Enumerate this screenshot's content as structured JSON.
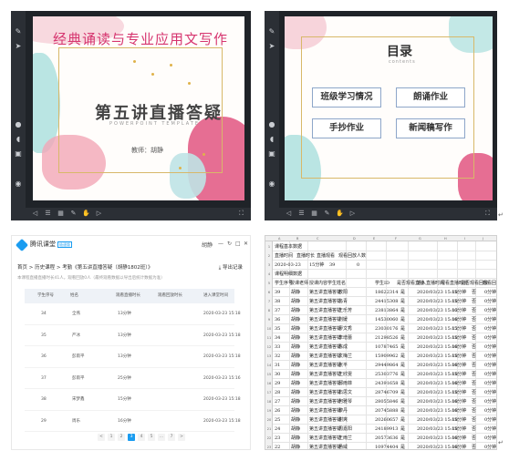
{
  "slide1": {
    "title": "经典诵读与专业应用文写作",
    "main_title": "第五讲直播答疑",
    "subtitle": "POWERPOINT TEMPLATE",
    "teacher": "教师：胡静"
  },
  "slide2": {
    "title": "目录",
    "subtitle": "contents",
    "items": [
      "班级学习情况",
      "朗诵作业",
      "手抄作业",
      "新闻稿写作"
    ]
  },
  "tencent": {
    "app_name": "腾讯课堂",
    "badge": "极速版",
    "user": "胡静",
    "window_controls": [
      "—",
      "↻",
      "□",
      "✕"
    ],
    "breadcrumb": "首页 > 历史课程 > 考勤《第五讲直播答疑（胡静1802班）》",
    "export_label": "导出记录",
    "note": "本课程直播直播时长41人，观看回放0人（最终观看数据以导出后统计数据为准）",
    "columns": [
      "学生序号",
      "姓名",
      "观看直播时长",
      "观看回放时长",
      "进入课堂时间"
    ],
    "rows": [
      [
        "34",
        "全燕",
        "13分钟",
        "",
        "2020-03-23 15:18"
      ],
      [
        "35",
        "严冰",
        "13分钟",
        "",
        "2020-03-23 15:18"
      ],
      [
        "36",
        "彭雨平",
        "13分钟",
        "",
        "2020-03-23 15:18"
      ],
      [
        "37",
        "彭雨平",
        "25分钟",
        "",
        "2020-03-23 15:16"
      ],
      [
        "38",
        "宋梦鑫",
        "15分钟",
        "",
        "2020-03-23 15:18"
      ],
      [
        "29",
        "周乐",
        "16分钟",
        "",
        "2020-03-23 15:18"
      ]
    ],
    "pager": [
      "<",
      "1",
      "2",
      "3",
      "4",
      "5",
      "...",
      "7",
      ">"
    ],
    "active_page": "3"
  },
  "sheet": {
    "col_letters": [
      "A",
      "B",
      "C",
      "D",
      "E",
      "F",
      "G",
      "H",
      "I",
      "J"
    ],
    "header_rows": [
      {
        "num": "1",
        "cells": [
          "课程基本数据"
        ]
      },
      {
        "num": "2",
        "cells": [
          "直播时间",
          "直播时长",
          "直播观看",
          "观看回放人数"
        ]
      },
      {
        "num": "3",
        "cells": [
          "2020-03-23",
          "15分钟",
          "39",
          "0"
        ]
      },
      {
        "num": "4",
        "cells": [
          "课程明细数据"
        ]
      },
      {
        "num": "5",
        "cells": [
          "学生序号",
          "授课老师",
          "授课内容",
          "学生姓名",
          "学生ID",
          "是否观看直播",
          "进入直播时间",
          "观看直播时长",
          "是否观看回放",
          "观看回放时长"
        ]
      }
    ],
    "data_rows": [
      {
        "num": "6",
        "cells": [
          "39",
          "胡静",
          "第五讲直播答疑",
          "欧阳",
          "18622314",
          "是",
          "2020/03/23 15:18",
          "15分钟",
          "否",
          "0分钟"
        ]
      },
      {
        "num": "7",
        "cells": [
          "38",
          "胡静",
          "第五讲直播答疑",
          "冯青",
          "24415308",
          "是",
          "2020/03/23 15:18",
          "15分钟",
          "否",
          "0分钟"
        ]
      },
      {
        "num": "8",
        "cells": [
          "37",
          "胡静",
          "第五讲直播答疑",
          "王乐芳",
          "23813864",
          "是",
          "2020/03/23 15:13",
          "16分钟",
          "否",
          "0分钟"
        ]
      },
      {
        "num": "9",
        "cells": [
          "36",
          "胡静",
          "第五讲直播答疑",
          "刘媛",
          "14530060",
          "是",
          "2020/03/23 15:18",
          "16分钟",
          "否",
          "0分钟"
        ]
      },
      {
        "num": "10",
        "cells": [
          "35",
          "胡静",
          "第五讲直播答疑",
          "廖文秀",
          "23030176",
          "是",
          "2020/03/23 15:13",
          "15分钟",
          "否",
          "0分钟"
        ]
      },
      {
        "num": "11",
        "cells": [
          "34",
          "胡静",
          "第五讲直播答疑",
          "李增蕾",
          "21298526",
          "是",
          "2020/03/23 15:18",
          "15分钟",
          "否",
          "0分钟"
        ]
      },
      {
        "num": "12",
        "cells": [
          "33",
          "胡静",
          "第五讲直播答疑",
          "陈成",
          "10787465",
          "是",
          "2020/03/23 15:18",
          "16分钟",
          "否",
          "0分钟"
        ]
      },
      {
        "num": "13",
        "cells": [
          "32",
          "胡静",
          "第五讲直播答疑",
          "文梅兰",
          "15909962",
          "是",
          "2020/03/23 15:18",
          "15分钟",
          "否",
          "0分钟"
        ]
      },
      {
        "num": "14",
        "cells": [
          "31",
          "胡静",
          "第五讲直播答疑",
          "张平",
          "29449864",
          "是",
          "2020/03/23 15:18",
          "16分钟",
          "否",
          "0分钟"
        ]
      },
      {
        "num": "15",
        "cells": [
          "30",
          "胡静",
          "第五讲直播答疑",
          "王欣雯",
          "25303776",
          "是",
          "2020/03/23 15:18",
          "15分钟",
          "否",
          "0分钟"
        ]
      },
      {
        "num": "16",
        "cells": [
          "29",
          "胡静",
          "第五讲直播答疑",
          "邱雨菲",
          "24391658",
          "是",
          "2020/03/23 15:18",
          "16分钟",
          "否",
          "0分钟"
        ]
      },
      {
        "num": "17",
        "cells": [
          "28",
          "胡静",
          "第五讲直播答疑",
          "石思文",
          "28746709",
          "是",
          "2020/03/23 15:18",
          "15分钟",
          "否",
          "0分钟"
        ]
      },
      {
        "num": "18",
        "cells": [
          "27",
          "胡静",
          "第五讲直播答疑",
          "何雅琴",
          "28055846",
          "是",
          "2020/03/23 15:18",
          "16分钟",
          "否",
          "0分钟"
        ]
      },
      {
        "num": "19",
        "cells": [
          "26",
          "胡静",
          "第五讲直播答疑",
          "黎丹",
          "20745888",
          "是",
          "2020/03/23 15:18",
          "16分钟",
          "否",
          "0分钟"
        ]
      },
      {
        "num": "20",
        "cells": [
          "25",
          "胡静",
          "第五讲直播答疑",
          "谢爽",
          "20260657",
          "是",
          "2020/03/23 15:18",
          "15分钟",
          "否",
          "0分钟"
        ]
      },
      {
        "num": "21",
        "cells": [
          "24",
          "胡静",
          "第五讲直播答疑",
          "周嘉阳",
          "24189913",
          "是",
          "2020/03/23 15:18",
          "15分钟",
          "否",
          "0分钟"
        ]
      },
      {
        "num": "22",
        "cells": [
          "23",
          "胡静",
          "第五讲直播答疑",
          "王雨兰",
          "20573636",
          "是",
          "2020/03/23 15:18",
          "16分钟",
          "否",
          "0分钟"
        ]
      },
      {
        "num": "23",
        "cells": [
          "22",
          "胡静",
          "第五讲直播答疑",
          "杨威",
          "10974404",
          "是",
          "2020/03/23 15:18",
          "16分钟",
          "否",
          "0分钟"
        ]
      }
    ]
  },
  "paragraph_mark": "↵",
  "sidebar_icons": [
    "pen-icon",
    "pointer-icon",
    "mic-icon",
    "speaker-icon",
    "camera-icon",
    "record-icon"
  ],
  "colors": {
    "accent_pink": "#d6356f",
    "accent_blue": "#1a9cf0",
    "gold": "#d8b869",
    "dark_ui": "#2b2f35"
  }
}
